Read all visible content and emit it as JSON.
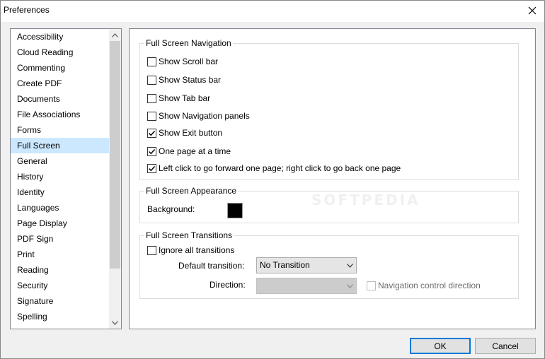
{
  "window": {
    "title": "Preferences"
  },
  "sidebar": {
    "items": [
      {
        "label": "Accessibility",
        "selected": false
      },
      {
        "label": "Cloud Reading",
        "selected": false
      },
      {
        "label": "Commenting",
        "selected": false
      },
      {
        "label": "Create PDF",
        "selected": false
      },
      {
        "label": "Documents",
        "selected": false
      },
      {
        "label": "File Associations",
        "selected": false
      },
      {
        "label": "Forms",
        "selected": false
      },
      {
        "label": "Full Screen",
        "selected": true
      },
      {
        "label": "General",
        "selected": false
      },
      {
        "label": "History",
        "selected": false
      },
      {
        "label": "Identity",
        "selected": false
      },
      {
        "label": "Languages",
        "selected": false
      },
      {
        "label": "Page Display",
        "selected": false
      },
      {
        "label": "PDF Sign",
        "selected": false
      },
      {
        "label": "Print",
        "selected": false
      },
      {
        "label": "Reading",
        "selected": false
      },
      {
        "label": "Security",
        "selected": false
      },
      {
        "label": "Signature",
        "selected": false
      },
      {
        "label": "Spelling",
        "selected": false
      }
    ]
  },
  "navigation": {
    "title": "Full Screen Navigation",
    "options": [
      {
        "label": "Show Scroll bar",
        "checked": false
      },
      {
        "label": "Show Status bar",
        "checked": false
      },
      {
        "label": "Show Tab bar",
        "checked": false
      },
      {
        "label": "Show Navigation panels",
        "checked": false
      },
      {
        "label": "Show Exit button",
        "checked": true
      },
      {
        "label": "One page at a time",
        "checked": true
      },
      {
        "label": "Left click to go forward one page; right click to go back one page",
        "checked": true
      }
    ]
  },
  "appearance": {
    "title": "Full Screen Appearance",
    "background_label": "Background:",
    "background_color": "#000000"
  },
  "transitions": {
    "title": "Full Screen Transitions",
    "ignore_label": "Ignore all transitions",
    "ignore_checked": false,
    "default_label": "Default transition:",
    "default_value": "No Transition",
    "direction_label": "Direction:",
    "direction_value": "",
    "nav_control_label": "Navigation control direction",
    "nav_control_checked": false
  },
  "buttons": {
    "ok": "OK",
    "cancel": "Cancel"
  },
  "watermark": "SOFTPEDIA",
  "colors": {
    "selection": "#cce8ff",
    "default_button_border": "#0078d7"
  }
}
